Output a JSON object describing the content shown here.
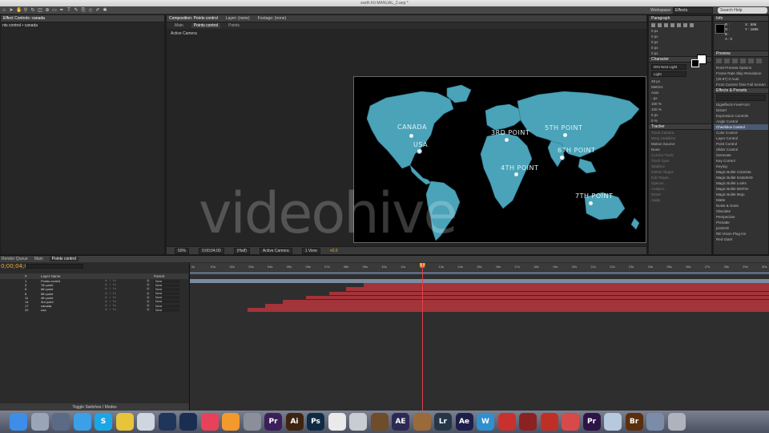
{
  "window": {
    "title": "earth Kit MANUAL_2.aep *"
  },
  "toolbar": {
    "workspace_label": "Workspace:",
    "workspace_value": "Effects",
    "search_placeholder": "Search Help"
  },
  "effect_controls": {
    "tabs": [
      "Effect Controls: canada"
    ],
    "layer_path": "nts control • canada"
  },
  "composition": {
    "tabs": [
      "Composition: Points control",
      "Layer: (none)",
      "Footage: (none)"
    ],
    "subtabs": [
      "Main",
      "Points control",
      "Points"
    ],
    "active_camera": "Active Camera",
    "footer": {
      "zoom": "50%",
      "timecode": "0;00;04;00",
      "resolution": "(Half)",
      "camera": "Active Camera",
      "views": "1 View",
      "exposure": "+0.0"
    },
    "points": [
      {
        "label": "CANADA"
      },
      {
        "label": "USA"
      },
      {
        "label": "3RD POINT"
      },
      {
        "label": "5TH POINT"
      },
      {
        "label": "6TH POINT"
      },
      {
        "label": "4TH POINT"
      },
      {
        "label": "7TH POINT"
      }
    ]
  },
  "watermark": "videohive",
  "paragraph": {
    "title": "Paragraph",
    "fields": [
      "0 px",
      "0 px",
      "0 px",
      "0 px",
      "0 px"
    ]
  },
  "character": {
    "title": "Character",
    "font": "DIN Next Light",
    "style": "Light",
    "size": "48 px",
    "tracking": "Metrics",
    "leading": "Auto",
    "kerning": "0",
    "stroke": "- px",
    "vscale": "100 %",
    "hscale": "100 %",
    "baseline": "0 px",
    "tsume": "0 %"
  },
  "tracker": {
    "title": "Tracker",
    "buttons": [
      "Track Camera",
      "Warp Stabilizer",
      "Track Motion",
      "Stabilize Motion"
    ],
    "motion_source_label": "Motion Source:",
    "motion_source": "None",
    "current_track_label": "Current Track:",
    "current_track": "None",
    "track_type_label": "Track Type:",
    "track_type": "Stabilize",
    "checks": [
      "Position",
      "Rotation",
      "Scale"
    ],
    "motion_target": "Motion Target:",
    "edit_target": "Edit Target...",
    "options": "Options...",
    "analyze": "Analyze:",
    "reset": "Reset",
    "apply": "Apply"
  },
  "info": {
    "title": "Info",
    "r": "R :",
    "g": "G :",
    "b": "B :",
    "a": "A : 0",
    "x": "X : 696",
    "y": "Y : 1696"
  },
  "preview": {
    "title": "Preview",
    "ram_options": "RAM Preview Options",
    "frame_rate": "Frame Rate",
    "skip": "Skip",
    "resolution": "Resolution",
    "fps": "(29.97)",
    "skip_val": "0",
    "res_val": "Auto",
    "from_current": "From Current Time",
    "full_screen": "Full Screen"
  },
  "effects_presets": {
    "title": "Effects & Presets",
    "items": [
      {
        "label": "Digieffects FreeForm",
        "selected": false
      },
      {
        "label": "Distort",
        "selected": false
      },
      {
        "label": "Expression Controls",
        "selected": false
      },
      {
        "label": "Angle Control",
        "selected": false
      },
      {
        "label": "Checkbox Control",
        "selected": true
      },
      {
        "label": "Color Control",
        "selected": false
      },
      {
        "label": "Layer Control",
        "selected": false
      },
      {
        "label": "Point Control",
        "selected": false
      },
      {
        "label": "Slider Control",
        "selected": false
      },
      {
        "label": "Generate",
        "selected": false
      },
      {
        "label": "Key Correct",
        "selected": false
      },
      {
        "label": "Keying",
        "selected": false
      },
      {
        "label": "Magic Bullet Colorista",
        "selected": false
      },
      {
        "label": "Magic Bullet InstantHD",
        "selected": false
      },
      {
        "label": "Magic Bullet Looks",
        "selected": false
      },
      {
        "label": "Magic Bullet MisFire",
        "selected": false
      },
      {
        "label": "Magic Bullet Mojo",
        "selected": false
      },
      {
        "label": "Matte",
        "selected": false
      },
      {
        "label": "Noise & Grain",
        "selected": false
      },
      {
        "label": "Obsolete",
        "selected": false
      },
      {
        "label": "Perspective",
        "selected": false
      },
      {
        "label": "Primatte",
        "selected": false
      },
      {
        "label": "proDAD",
        "selected": false
      },
      {
        "label": "RE:Vision Plug-ins",
        "selected": false
      },
      {
        "label": "Red Giant",
        "selected": false
      }
    ]
  },
  "timeline": {
    "tabs": [
      "Render Queue",
      "Main",
      "Points control"
    ],
    "timecode": "0;00;04;00",
    "header": {
      "num": "#",
      "layer_name": "Layer Name",
      "parent": "Parent"
    },
    "ruler_ticks": [
      "0s",
      "01s",
      "02s",
      "03s",
      "04s",
      "05s",
      "06s",
      "07s",
      "08s",
      "09s",
      "10s",
      "11s",
      "12s",
      "13s",
      "14s",
      "15s",
      "16s",
      "17s",
      "18s",
      "19s",
      "20s",
      "21s",
      "22s",
      "23s",
      "24s",
      "25s",
      "26s",
      "27s",
      "28s",
      "29s",
      "30s"
    ],
    "layers": [
      {
        "num": "1",
        "name": "Points control",
        "mode": "None",
        "start": 0.0
      },
      {
        "num": "3",
        "name": "7th point",
        "mode": "None",
        "start": 0.3
      },
      {
        "num": "5",
        "name": "6th point",
        "mode": "None",
        "start": 0.27
      },
      {
        "num": "8",
        "name": "5th point",
        "mode": "None",
        "start": 0.24
      },
      {
        "num": "11",
        "name": "4th point",
        "mode": "None",
        "start": 0.2
      },
      {
        "num": "14",
        "name": "3rd point",
        "mode": "None",
        "start": 0.16
      },
      {
        "num": "17",
        "name": "canada",
        "mode": "None",
        "start": 0.13
      },
      {
        "num": "20",
        "name": "usa",
        "mode": "None",
        "start": 0.1
      }
    ],
    "playhead_fraction": 0.4,
    "toggle_label": "Toggle Switches / Modes"
  },
  "dock": {
    "apps": [
      {
        "name": "finder-icon",
        "color": "#3d8ee8",
        "glyph": ""
      },
      {
        "name": "launchpad-icon",
        "color": "#9aa6b8",
        "glyph": ""
      },
      {
        "name": "mission-control-icon",
        "color": "#5b6a85",
        "glyph": ""
      },
      {
        "name": "safari-icon",
        "color": "#3aa0e8",
        "glyph": ""
      },
      {
        "name": "skype-icon",
        "color": "#1ba7e6",
        "glyph": "S"
      },
      {
        "name": "chrome-icon",
        "color": "#e7c43a",
        "glyph": ""
      },
      {
        "name": "mail-icon",
        "color": "#d0d6df",
        "glyph": ""
      },
      {
        "name": "cinema4d-icon",
        "color": "#20355a",
        "glyph": ""
      },
      {
        "name": "cinema4d-alt-icon",
        "color": "#1a2e52",
        "glyph": ""
      },
      {
        "name": "itunes-icon",
        "color": "#e8425a",
        "glyph": ""
      },
      {
        "name": "ibooks-icon",
        "color": "#f39a2c",
        "glyph": ""
      },
      {
        "name": "system-preferences-icon",
        "color": "#8a8f99",
        "glyph": ""
      },
      {
        "name": "premiere-icon",
        "color": "#3b1f5a",
        "glyph": "Pr"
      },
      {
        "name": "illustrator-icon",
        "color": "#3e2410",
        "glyph": "Ai"
      },
      {
        "name": "photoshop-icon",
        "color": "#0f2b44",
        "glyph": "Ps"
      },
      {
        "name": "textedit-icon",
        "color": "#eaeaea",
        "glyph": ""
      },
      {
        "name": "disk-utility-icon",
        "color": "#c9ccd2",
        "glyph": ""
      },
      {
        "name": "archive-icon",
        "color": "#6f4d2a",
        "glyph": ""
      },
      {
        "name": "after-effects-icon",
        "color": "#2c2a55",
        "glyph": "AE"
      },
      {
        "name": "toy-story-icon",
        "color": "#9a6a3a",
        "glyph": ""
      },
      {
        "name": "lightroom-icon",
        "color": "#253746",
        "glyph": "Lr"
      },
      {
        "name": "after-effects-cc-icon",
        "color": "#1e1e4a",
        "glyph": "Ae"
      },
      {
        "name": "wordpress-icon",
        "color": "#2f8fcf",
        "glyph": "W"
      },
      {
        "name": "pen-tool-icon",
        "color": "#c9312f",
        "glyph": ""
      },
      {
        "name": "photo-booth-icon",
        "color": "#8a2222",
        "glyph": ""
      },
      {
        "name": "filezilla-icon",
        "color": "#bf2f26",
        "glyph": ""
      },
      {
        "name": "plugin-icon",
        "color": "#d84a4a",
        "glyph": ""
      },
      {
        "name": "premiere-cc-icon",
        "color": "#2d1446",
        "glyph": "Pr"
      },
      {
        "name": "preview-icon",
        "color": "#b7c9dd",
        "glyph": ""
      },
      {
        "name": "bridge-icon",
        "color": "#5a2f0e",
        "glyph": "Br"
      },
      {
        "name": "folder-icon",
        "color": "#7a8ca8",
        "glyph": ""
      },
      {
        "name": "trash-icon",
        "color": "#aeb4bd",
        "glyph": ""
      }
    ]
  }
}
